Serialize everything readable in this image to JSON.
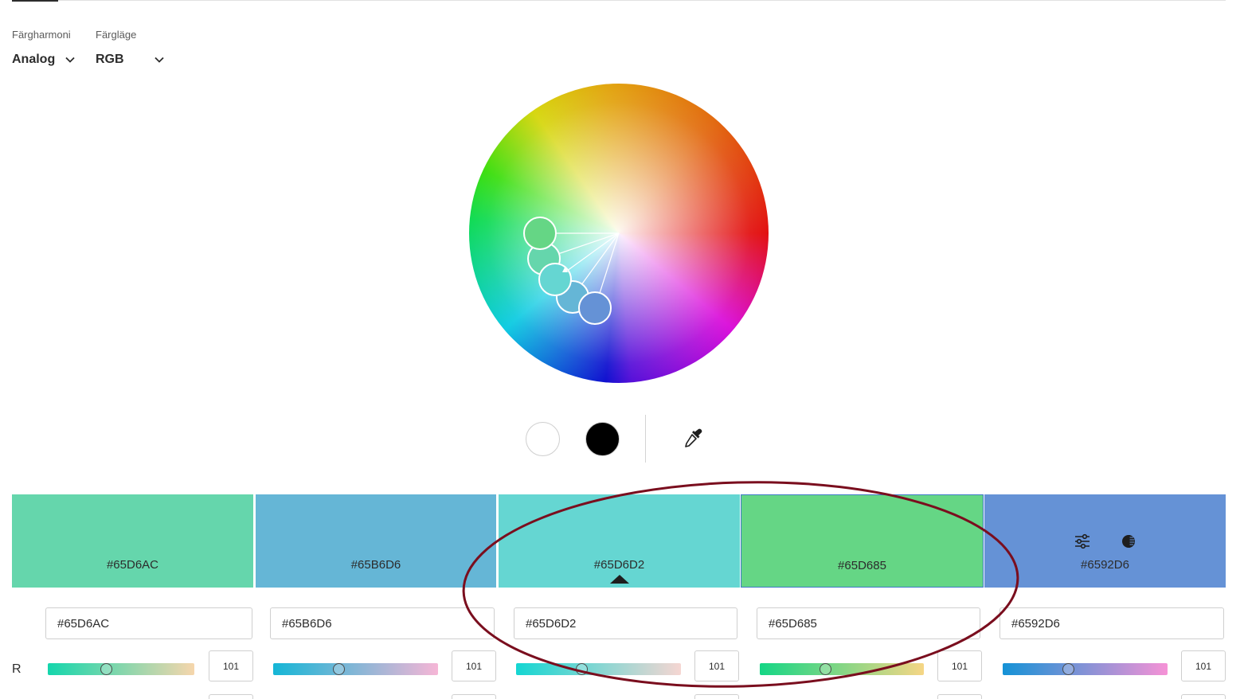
{
  "header": {
    "harmony_label": "Färgharmoni",
    "harmony_value": "Analog",
    "mode_label": "Färgläge",
    "mode_value": "RGB"
  },
  "wheel": {
    "handle_colors": [
      "#65D685",
      "#65D6AC",
      "#65D6D2",
      "#65B6D6",
      "#6592D6"
    ]
  },
  "tools": {
    "white_swatch": "#FFFFFF",
    "black_swatch": "#000000",
    "icons": [
      "eyedropper-icon",
      "adjustments-icon",
      "contrast-icon"
    ]
  },
  "swatches": [
    {
      "hex": "#65D6AC",
      "color": "#65D6AC"
    },
    {
      "hex": "#65B6D6",
      "color": "#65B6D6"
    },
    {
      "hex": "#65D6D2",
      "color": "#65D6D2"
    },
    {
      "hex": "#65D685",
      "color": "#65D685"
    },
    {
      "hex": "#6592D6",
      "color": "#6592D6"
    }
  ],
  "inputs": {
    "hex_values": [
      "#65D6AC",
      "#65B6D6",
      "#65D6D2",
      "#65D685",
      "#6592D6"
    ]
  },
  "channel_r": {
    "label": "R",
    "values": [
      "101",
      "101",
      "101",
      "101",
      "101"
    ],
    "gradients": [
      [
        "#14d6ac",
        "#f6d6ac"
      ],
      [
        "#14b6d6",
        "#f6b6d6"
      ],
      [
        "#14d6d2",
        "#f6d6d2"
      ],
      [
        "#14d685",
        "#f6d685"
      ],
      [
        "#1492d6",
        "#f692d6"
      ]
    ]
  },
  "colors": {
    "annotation_ring": "#7a0e1e",
    "selected_border": "#3d78c8"
  }
}
